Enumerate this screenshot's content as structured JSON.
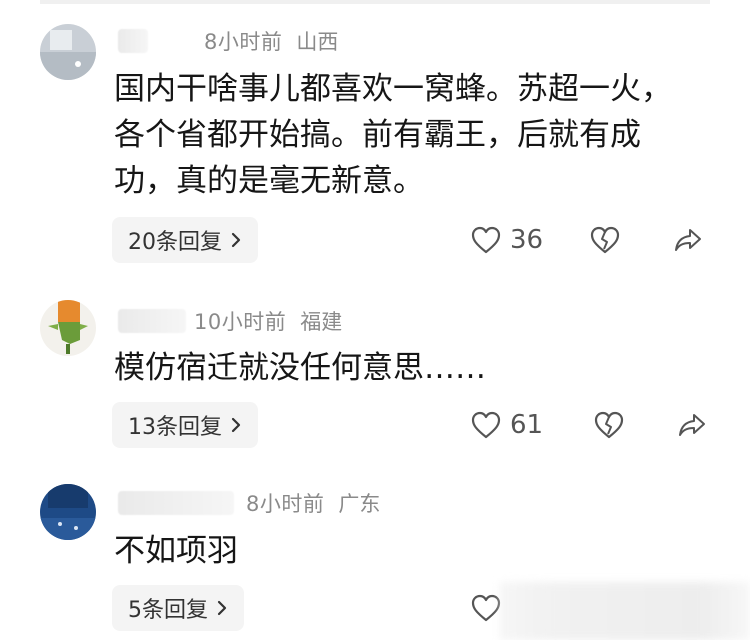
{
  "comments": [
    {
      "time": "8小时前",
      "location": "山西",
      "lines": [
        "国内干啥事儿都喜欢一窝蜂。苏超一火，",
        "各个省都开始搞。前有霸王，后就有成",
        "功，真的是毫无新意。"
      ],
      "reply_label": "20条回复",
      "likes": "36"
    },
    {
      "time": "10小时前",
      "location": "福建",
      "lines": [
        "模仿宿迁就没任何意思……"
      ],
      "reply_label": "13条回复",
      "likes": "61"
    },
    {
      "time": "8小时前",
      "location": "广东",
      "lines": [
        "不如项羽"
      ],
      "reply_label": "5条回复"
    }
  ],
  "icons": {
    "like": "heart-icon",
    "dislike": "broken-heart-icon",
    "share": "share-arrow-icon",
    "chevron": "chevron-right-icon"
  },
  "colors": {
    "meta_gray": "#8a8a8a",
    "reply_bg": "#f4f4f4",
    "text": "#161616"
  }
}
